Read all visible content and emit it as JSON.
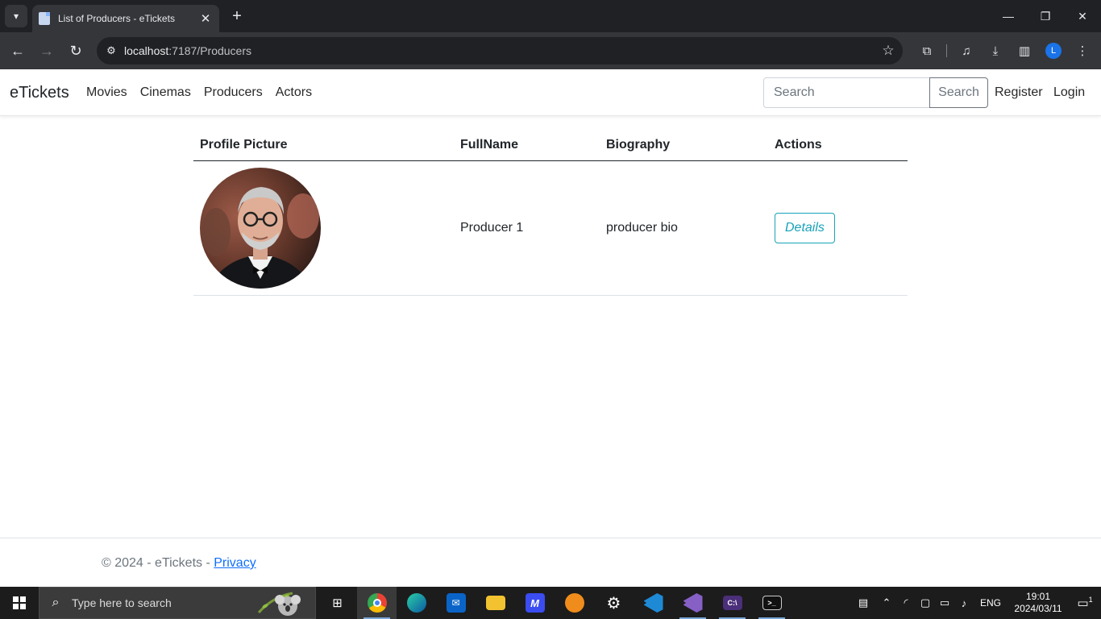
{
  "browser": {
    "tab_title": "List of Producers - eTickets",
    "url_host": "localhost",
    "url_path": ":7187/Producers",
    "profile_initial": "L"
  },
  "navbar": {
    "brand": "eTickets",
    "links": [
      "Movies",
      "Cinemas",
      "Producers",
      "Actors"
    ],
    "search_placeholder": "Search",
    "search_button": "Search",
    "register": "Register",
    "login": "Login"
  },
  "table": {
    "headers": [
      "Profile Picture",
      "FullName",
      "Biography",
      "Actions"
    ],
    "rows": [
      {
        "full_name": "Producer 1",
        "biography": "producer bio",
        "action": "Details"
      }
    ]
  },
  "footer": {
    "text": "© 2024 - eTickets - ",
    "privacy": "Privacy"
  },
  "taskbar": {
    "search_placeholder": "Type here to search",
    "language": "ENG",
    "time": "19:01",
    "date": "2024/03/11",
    "notification_count": "1"
  },
  "colors": {
    "info": "#17a2b8",
    "link": "#0d6efd",
    "chrome_dark": "#202124",
    "chrome_toolbar": "#35363a"
  }
}
